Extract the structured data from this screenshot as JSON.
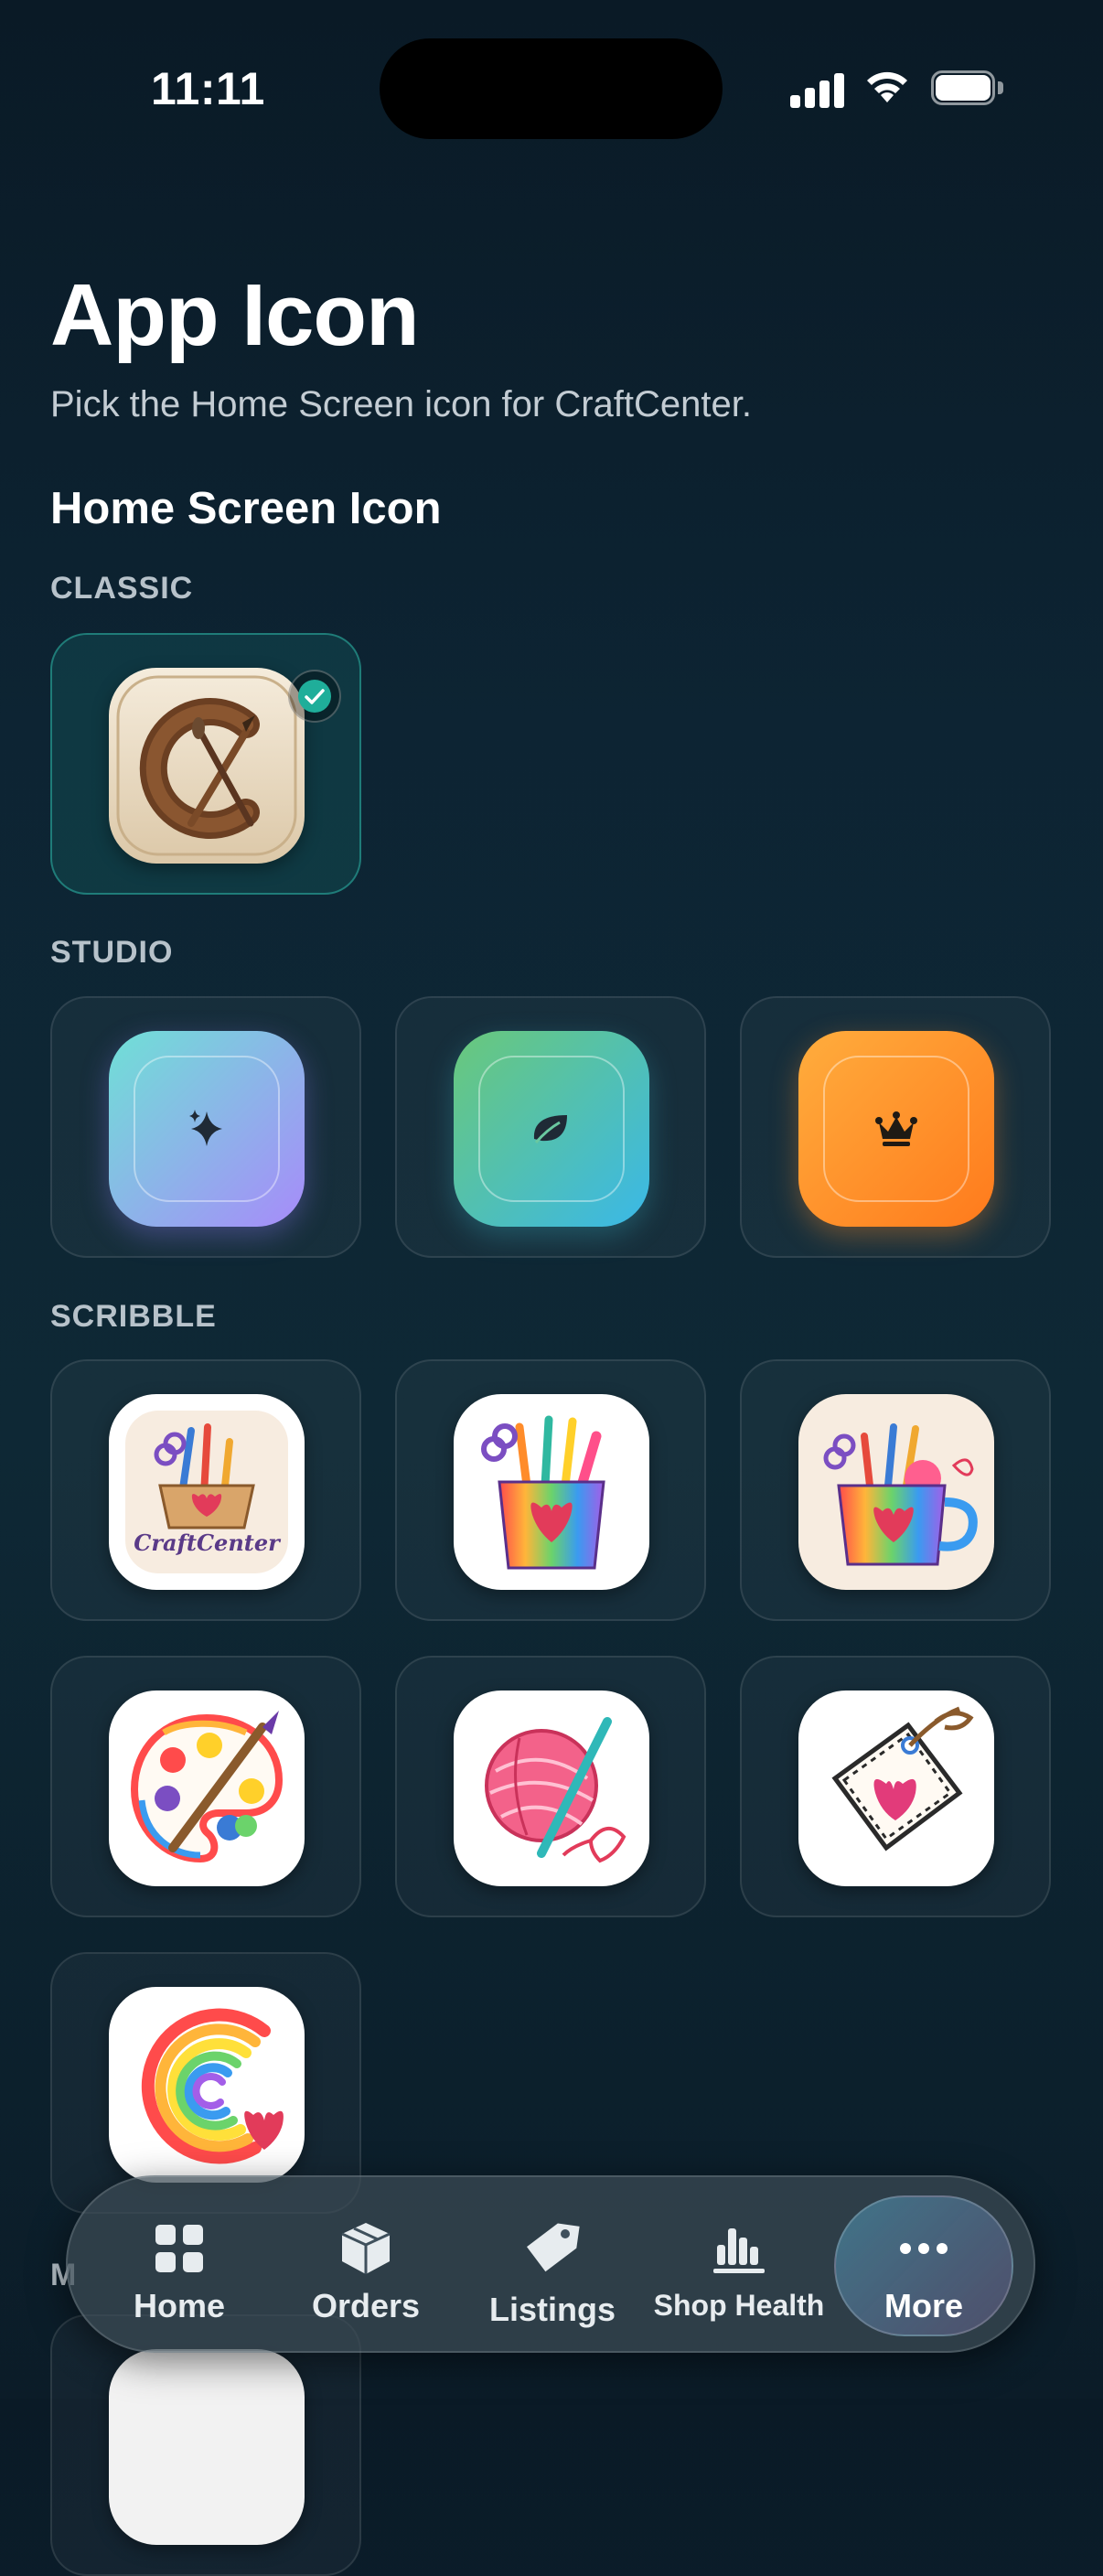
{
  "status": {
    "time": "11:11"
  },
  "page": {
    "title": "App Icon",
    "subtitle": "Pick the Home Screen icon for CraftCenter.",
    "section_title": "Home Screen Icon"
  },
  "groups": {
    "classic": {
      "label": "CLASSIC",
      "icons": [
        "classic-monogram"
      ],
      "selected": "classic-monogram"
    },
    "studio": {
      "label": "STUDIO",
      "icons": [
        "sparkle",
        "leaf",
        "crown"
      ]
    },
    "scribble": {
      "label": "SCRIBBLE",
      "icons": [
        "craftcenter-basket",
        "rainbow-cup",
        "heart-mug",
        "paint-palette",
        "yarn-crochet",
        "heart-tag",
        "rainbow-c-heart"
      ],
      "badge_text": "CraftCenter"
    },
    "next_partial_label": "M"
  },
  "tabs": [
    {
      "label": "Home",
      "icon": "grid-icon"
    },
    {
      "label": "Orders",
      "icon": "box-icon"
    },
    {
      "label": "Listings",
      "icon": "tag-icon"
    },
    {
      "label": "Shop Health",
      "icon": "chart-icon"
    },
    {
      "label": "More",
      "icon": "ellipsis-icon",
      "active": true
    }
  ],
  "colors": {
    "accent": "#1fae9a",
    "studio_gradients": [
      [
        "#6fe0d6",
        "#a78bfa"
      ],
      [
        "#6ac87a",
        "#3ab8e8"
      ],
      [
        "#ffad3d",
        "#ff7a1c"
      ]
    ]
  }
}
